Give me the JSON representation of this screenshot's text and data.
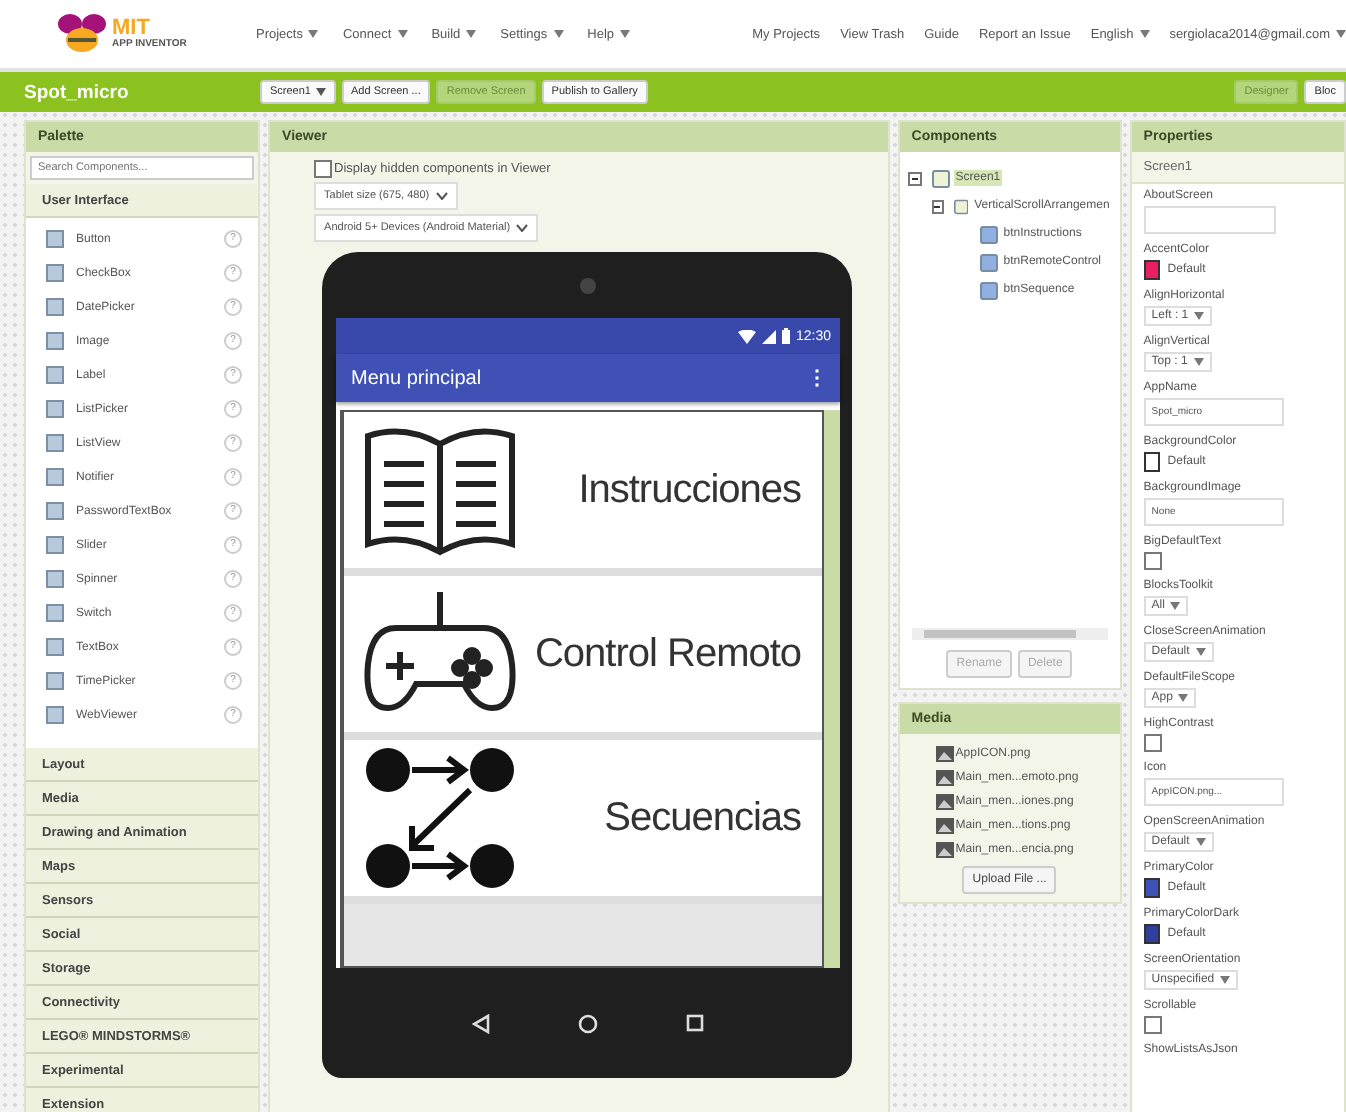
{
  "topbar": {
    "logo_title": "MIT",
    "logo_subtitle": "APP INVENTOR",
    "menus": [
      {
        "label": "Projects",
        "dropdown": true
      },
      {
        "label": "Connect",
        "dropdown": true
      },
      {
        "label": "Build",
        "dropdown": true
      },
      {
        "label": "Settings",
        "dropdown": true
      },
      {
        "label": "Help",
        "dropdown": true
      }
    ],
    "links": [
      {
        "label": "My Projects",
        "dropdown": false
      },
      {
        "label": "View Trash",
        "dropdown": false
      },
      {
        "label": "Guide",
        "dropdown": false
      },
      {
        "label": "Report an Issue",
        "dropdown": false
      },
      {
        "label": "English",
        "dropdown": true
      },
      {
        "label": "sergiolaca2014@gmail.com",
        "dropdown": true
      }
    ]
  },
  "project_bar": {
    "title": "Spot_micro",
    "buttons": [
      {
        "label": "Screen1",
        "dropdown": true,
        "disabled": false
      },
      {
        "label": "Add Screen ...",
        "dropdown": false,
        "disabled": false
      },
      {
        "label": "Remove Screen",
        "dropdown": false,
        "disabled": true
      },
      {
        "label": "Publish to Gallery",
        "dropdown": false,
        "disabled": false
      }
    ],
    "modes": [
      {
        "label": "Designer",
        "selected": true
      },
      {
        "label": "Bloc",
        "selected": false
      }
    ]
  },
  "palette": {
    "title": "Palette",
    "search": {
      "placeholder": "Search Components..."
    },
    "sections": [
      {
        "label": "User Interface",
        "expanded": true,
        "items": [
          {
            "label": "Button",
            "help": "?"
          },
          {
            "label": "CheckBox",
            "help": "?"
          },
          {
            "label": "DatePicker",
            "help": "?"
          },
          {
            "label": "Image",
            "help": "?"
          },
          {
            "label": "Label",
            "help": "?"
          },
          {
            "label": "ListPicker",
            "help": "?"
          },
          {
            "label": "ListView",
            "help": "?"
          },
          {
            "label": "Notifier",
            "help": "?"
          },
          {
            "label": "PasswordTextBox",
            "help": "?"
          },
          {
            "label": "Slider",
            "help": "?"
          },
          {
            "label": "Spinner",
            "help": "?"
          },
          {
            "label": "Switch",
            "help": "?"
          },
          {
            "label": "TextBox",
            "help": "?"
          },
          {
            "label": "TimePicker",
            "help": "?"
          },
          {
            "label": "WebViewer",
            "help": "?"
          }
        ]
      },
      {
        "label": "Layout",
        "expanded": false
      },
      {
        "label": "Media",
        "expanded": false
      },
      {
        "label": "Drawing and Animation",
        "expanded": false
      },
      {
        "label": "Maps",
        "expanded": false
      },
      {
        "label": "Sensors",
        "expanded": false
      },
      {
        "label": "Social",
        "expanded": false
      },
      {
        "label": "Storage",
        "expanded": false
      },
      {
        "label": "Connectivity",
        "expanded": false
      },
      {
        "label": "LEGO® MINDSTORMS®",
        "expanded": false
      },
      {
        "label": "Experimental",
        "expanded": false
      },
      {
        "label": "Extension",
        "expanded": false
      }
    ]
  },
  "viewer": {
    "title": "Viewer",
    "hidden_checkbox": {
      "label": "Display hidden components in Viewer",
      "checked": false
    },
    "size_select": "Tablet size (675, 480)",
    "theme_select": "Android 5+ Devices (Android Material)",
    "phone": {
      "time": "12:30",
      "app_title": "Menu principal",
      "menu_glyph": "⋮",
      "buttons": [
        {
          "kind": "book",
          "label": "Instrucciones"
        },
        {
          "kind": "gamepad",
          "label": "Control Remoto"
        },
        {
          "kind": "sequence",
          "label": "Secuencias"
        }
      ]
    }
  },
  "components": {
    "title": "Components",
    "tree": [
      {
        "label": "Screen1",
        "selected": true,
        "expanded": true,
        "children": [
          {
            "label": "VerticalScrollArrangemen",
            "selected": false,
            "expanded": true,
            "children": [
              {
                "label": "btnInstructions",
                "selected": false
              },
              {
                "label": "btnRemoteControl",
                "selected": false
              },
              {
                "label": "btnSequence",
                "selected": false
              }
            ]
          }
        ]
      }
    ],
    "buttons": [
      {
        "label": "Rename",
        "disabled": true
      },
      {
        "label": "Delete",
        "disabled": true
      }
    ]
  },
  "media": {
    "title": "Media",
    "files": [
      "AppICON.png",
      "Main_men...emoto.png",
      "Main_men...iones.png",
      "Main_men...tions.png",
      "Main_men...encia.png"
    ],
    "upload": "Upload File ..."
  },
  "properties": {
    "title": "Properties",
    "target": "Screen1",
    "items": [
      {
        "label": "AboutScreen",
        "kind": "textarea"
      },
      {
        "label": "AccentColor",
        "kind": "color",
        "color": "#e91e63",
        "value": "Default"
      },
      {
        "label": "AlignHorizontal",
        "kind": "select",
        "value": "Left : 1"
      },
      {
        "label": "AlignVertical",
        "kind": "select",
        "value": "Top : 1"
      },
      {
        "label": "AppName",
        "kind": "text",
        "value": "Spot_micro"
      },
      {
        "label": "BackgroundColor",
        "kind": "color",
        "color": "#ffffff",
        "value": "Default"
      },
      {
        "label": "BackgroundImage",
        "kind": "text",
        "value": "None"
      },
      {
        "label": "BigDefaultText",
        "kind": "checkbox",
        "checked": false
      },
      {
        "label": "BlocksToolkit",
        "kind": "select",
        "value": "All"
      },
      {
        "label": "CloseScreenAnimation",
        "kind": "select",
        "value": "Default"
      },
      {
        "label": "DefaultFileScope",
        "kind": "select",
        "value": "App"
      },
      {
        "label": "HighContrast",
        "kind": "checkbox",
        "checked": false
      },
      {
        "label": "Icon",
        "kind": "text",
        "value": "AppICON.png..."
      },
      {
        "label": "OpenScreenAnimation",
        "kind": "select",
        "value": "Default"
      },
      {
        "label": "PrimaryColor",
        "kind": "color",
        "color": "#3f51b5",
        "value": "Default"
      },
      {
        "label": "PrimaryColorDark",
        "kind": "color",
        "color": "#303f9f",
        "value": "Default"
      },
      {
        "label": "ScreenOrientation",
        "kind": "select",
        "value": "Unspecified"
      },
      {
        "label": "Scrollable",
        "kind": "checkbox",
        "checked": false
      },
      {
        "label": "ShowListsAsJson",
        "kind": "label"
      }
    ]
  }
}
